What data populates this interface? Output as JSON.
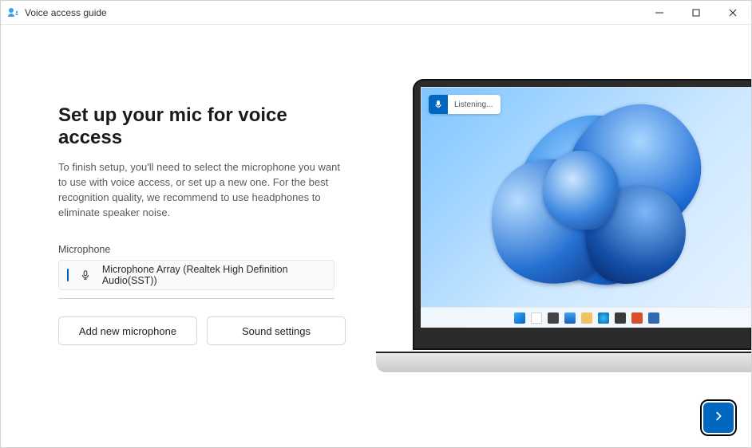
{
  "window": {
    "title": "Voice access guide"
  },
  "main": {
    "heading": "Set up your mic for voice access",
    "body": "To finish setup, you'll need to select the microphone you want to use with voice access, or set up a new one. For the best recognition quality, we recommend to use headphones to eliminate speaker noise.",
    "mic_label": "Microphone",
    "selected_mic": "Microphone Array (Realtek High Definition Audio(SST))",
    "add_mic_label": "Add new microphone",
    "sound_settings_label": "Sound settings"
  },
  "preview": {
    "status_text": "Listening..."
  },
  "colors": {
    "accent": "#0067c0"
  }
}
